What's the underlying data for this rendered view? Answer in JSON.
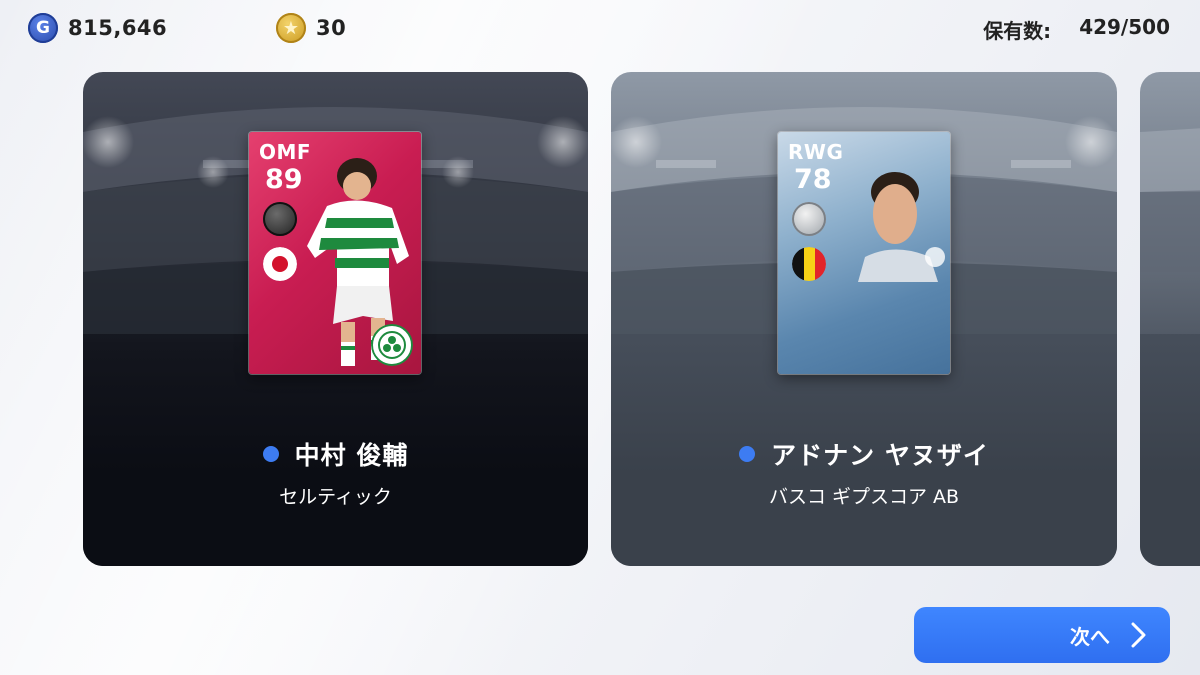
{
  "currency": {
    "gp": {
      "icon": "g-coin-icon",
      "badge": "G",
      "value": "815,646"
    },
    "coins": {
      "icon": "star-coin-icon",
      "value": "30"
    }
  },
  "holding": {
    "label": "保有数:",
    "value": "429/500"
  },
  "cards": [
    {
      "position": "OMF",
      "rating": "89",
      "player_name": "中村 俊輔",
      "club": "セルティック",
      "card_color": "#d4285a",
      "flag": "japan-flag-icon"
    },
    {
      "position": "RWG",
      "rating": "78",
      "player_name": "アドナン ヤヌザイ",
      "club": "バスコ ギプスコア AB",
      "card_color": "#6a95bd",
      "flag": "belgium-flag-icon"
    }
  ],
  "next_button": {
    "label": "次へ",
    "color": "#3378f6"
  },
  "accent_dot_color": "#3d7cf2"
}
